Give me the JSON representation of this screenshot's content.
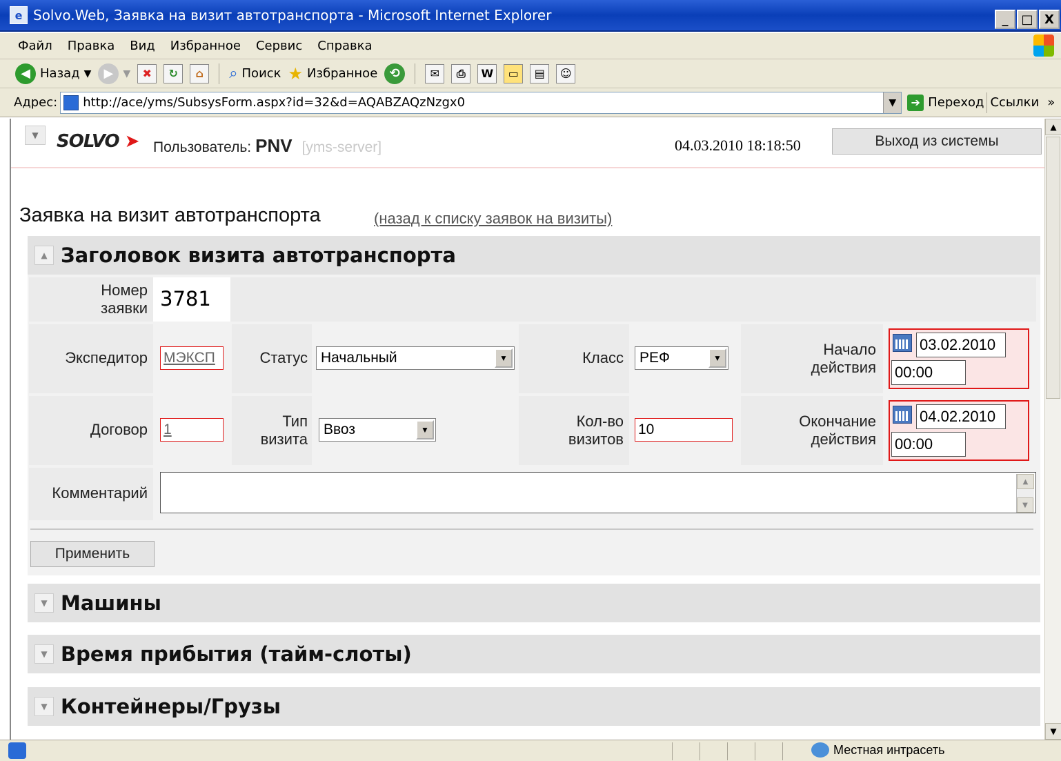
{
  "window": {
    "title": "Solvo.Web, Заявка на визит автотранспорта - Microsoft Internet Explorer",
    "min": "_",
    "max": "□",
    "close": "X"
  },
  "menu": [
    "Файл",
    "Правка",
    "Вид",
    "Избранное",
    "Сервис",
    "Справка"
  ],
  "toolbar": {
    "back": "Назад",
    "search": "Поиск",
    "favorites": "Избранное"
  },
  "address": {
    "label": "Адрес:",
    "url": "http://ace/yms/SubsysForm.aspx?id=32&d=AQABZAQzNzgx0",
    "go": "Переход",
    "links": "Ссылки"
  },
  "header": {
    "logo": "SOLVO",
    "user_label": "Пользователь:",
    "user_name": "PNV",
    "server": "[yms-server]",
    "datetime": "04.03.2010 18:18:50",
    "logout": "Выход из системы"
  },
  "page": {
    "title": "Заявка на визит автотранспорта",
    "back_link": "(назад к списку заявок на визиты)"
  },
  "form": {
    "section_title": "Заголовок визита автотранспорта",
    "number_label": "Номер\nзаявки",
    "number_value": "3781",
    "forwarder_label": "Экспедитор",
    "forwarder_value": "МЭКСП",
    "status_label": "Статус",
    "status_value": "Начальный",
    "class_label": "Класс",
    "class_value": "РЕФ",
    "start_label": "Начало\nдействия",
    "start_date": "03.02.2010",
    "start_time": "00:00",
    "contract_label": "Договор",
    "contract_value": "1",
    "visit_type_label": "Тип\nвизита",
    "visit_type_value": "Ввоз",
    "visits_count_label": "Кол-во\nвизитов",
    "visits_count_value": "10",
    "end_label": "Окончание\nдействия",
    "end_date": "04.02.2010",
    "end_time": "00:00",
    "comment_label": "Комментарий",
    "comment_value": "",
    "apply": "Применить"
  },
  "sections": [
    "Машины",
    "Время прибытия (тайм-слоты)",
    "Контейнеры/Грузы"
  ],
  "statusbar": {
    "zone": "Местная интрасеть"
  },
  "icons": {
    "back": "back-arrow-icon",
    "forward": "forward-arrow-icon",
    "stop": "stop-icon",
    "refresh": "refresh-icon",
    "home": "home-icon",
    "search": "search-icon",
    "favorites": "star-icon",
    "history": "history-icon",
    "mail": "mail-icon",
    "print": "print-icon",
    "edit": "edit-icon",
    "calendar": "calendar-icon"
  },
  "colors": {
    "titlebar": "#0a3fb8",
    "required_border": "#e01818",
    "section_bg": "#e2e2e2"
  }
}
